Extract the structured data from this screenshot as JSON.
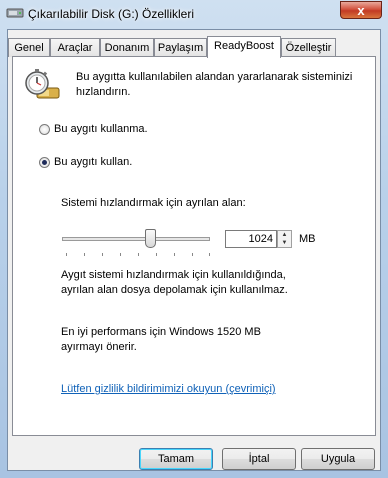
{
  "window": {
    "title": "Çıkarılabilir Disk (G:) Özellikleri",
    "close_glyph": "x"
  },
  "tabs": [
    {
      "label": "Genel"
    },
    {
      "label": "Araçlar"
    },
    {
      "label": "Donanım"
    },
    {
      "label": "Paylaşım"
    },
    {
      "label": "ReadyBoost",
      "selected": true
    },
    {
      "label": "Özelleştir"
    }
  ],
  "readyboost": {
    "header_icon": "stopwatch-drive-icon",
    "description": "Bu aygıtta kullanılabilen alandan yararlanarak sisteminizi hızlandırın.",
    "options": [
      {
        "label": "Bu aygıtı kullanma.",
        "checked": false
      },
      {
        "label": "Bu aygıtı kullan.",
        "checked": true
      }
    ],
    "reserve_label": "Sistemi hızlandırmak için ayrılan alan:",
    "slider_level_fraction": 0.59,
    "space_value": "1024",
    "space_unit": "MB",
    "note": "Aygıt sistemi hızlandırmak için kullanıldığında, ayrılan alan dosya depolamak için kullanılmaz.",
    "recommendation": "En iyi performans için Windows 1520 MB ayırmayı önerir.",
    "privacy_link": "Lütfen gizlilik bildirimimizi okuyun (çevrimiçi)"
  },
  "buttons": {
    "ok": "Tamam",
    "cancel": "İptal",
    "apply": "Uygula"
  }
}
